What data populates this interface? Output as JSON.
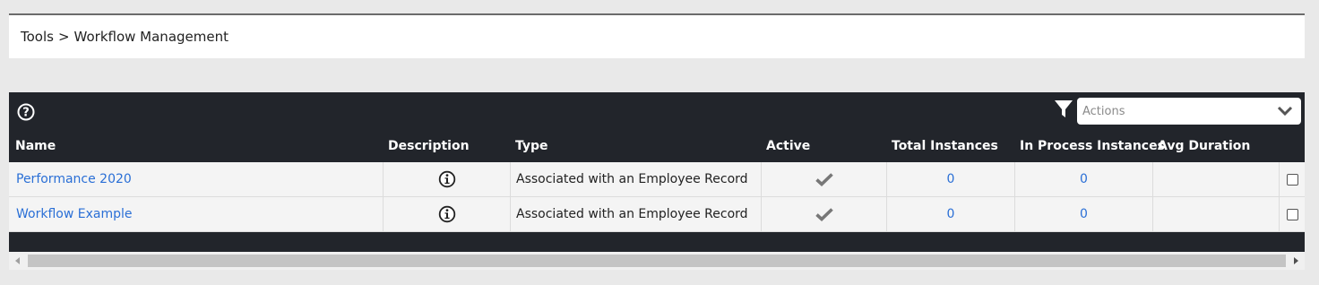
{
  "breadcrumb": {
    "parent": "Tools",
    "separator": ">",
    "current": "Workflow Management"
  },
  "toolbar": {
    "actions_placeholder": "Actions"
  },
  "table": {
    "headers": {
      "name": "Name",
      "description": "Description",
      "type": "Type",
      "active": "Active",
      "total": "Total Instances",
      "inprocess": "In Process Instances",
      "avg": "Avg Duration"
    },
    "rows": [
      {
        "name": "Performance 2020",
        "type": "Associated with an Employee Record",
        "active": true,
        "total": "0",
        "inprocess": "0",
        "avg": ""
      },
      {
        "name": "Workflow Example",
        "type": "Associated with an Employee Record",
        "active": true,
        "total": "0",
        "inprocess": "0",
        "avg": ""
      }
    ]
  },
  "colors": {
    "panel_bg": "#22252b",
    "link": "#2a6fd6",
    "row_bg": "#f4f4f4",
    "page_bg": "#e9e9e9"
  }
}
